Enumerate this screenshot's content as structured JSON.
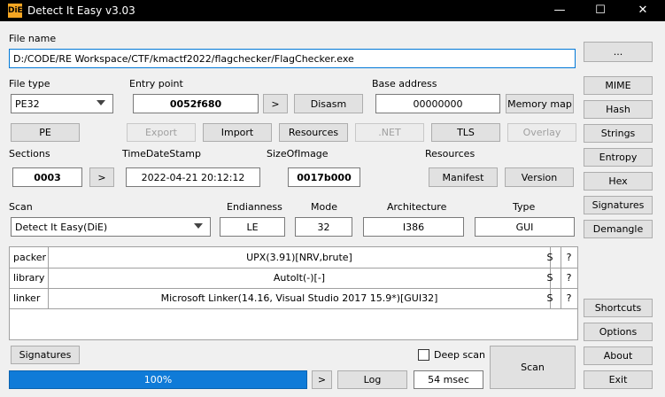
{
  "window": {
    "title": "Detect It Easy v3.03",
    "logo_text": "DiE",
    "min": "—",
    "max": "☐",
    "close": "✕"
  },
  "file": {
    "label": "File name",
    "path": "D:/CODE/RE Workspace/CTF/kmactf2022/flagchecker/FlagChecker.exe",
    "browse": "..."
  },
  "file_type": {
    "label": "File type",
    "value": "PE32"
  },
  "entry_point": {
    "label": "Entry point",
    "value": "0052f680",
    "go": ">",
    "disasm": "Disasm"
  },
  "base_address": {
    "label": "Base address",
    "value": "00000000",
    "memory_map": "Memory map"
  },
  "pe_row": {
    "pe": "PE",
    "export": "Export",
    "import": "Import",
    "resources": "Resources",
    "net": ".NET",
    "tls": "TLS",
    "overlay": "Overlay"
  },
  "sections": {
    "label": "Sections",
    "value": "0003",
    "go": ">"
  },
  "timestamp": {
    "label": "TimeDateStamp",
    "value": "2022-04-21 20:12:12"
  },
  "size_of_image": {
    "label": "SizeOfImage",
    "value": "0017b000"
  },
  "resources_group": {
    "label": "Resources",
    "manifest": "Manifest",
    "version": "Version"
  },
  "scan": {
    "label": "Scan",
    "engine": "Detect It Easy(DiE)"
  },
  "endianness": {
    "label": "Endianness",
    "value": "LE"
  },
  "mode": {
    "label": "Mode",
    "value": "32"
  },
  "architecture": {
    "label": "Architecture",
    "value": "I386"
  },
  "type": {
    "label": "Type",
    "value": "GUI"
  },
  "results": [
    {
      "kind": "packer",
      "name": "UPX(3.91)[NRV,brute]",
      "s": "S",
      "q": "?"
    },
    {
      "kind": "library",
      "name": "AutoIt(-)[-]",
      "s": "S",
      "q": "?"
    },
    {
      "kind": "linker",
      "name": "Microsoft Linker(14.16, Visual Studio 2017 15.9*)[GUI32]",
      "s": "S",
      "q": "?"
    }
  ],
  "right_buttons": {
    "mime": "MIME",
    "hash": "Hash",
    "strings": "Strings",
    "entropy": "Entropy",
    "hex": "Hex",
    "signatures": "Signatures",
    "demangle": "Demangle",
    "shortcuts": "Shortcuts",
    "options": "Options",
    "about": "About",
    "exit": "Exit"
  },
  "bottom": {
    "signatures": "Signatures",
    "deep_scan": "Deep scan",
    "progress_text": "100%",
    "progress": 1.0,
    "go": ">",
    "log": "Log",
    "time": "54 msec",
    "scan": "Scan"
  }
}
